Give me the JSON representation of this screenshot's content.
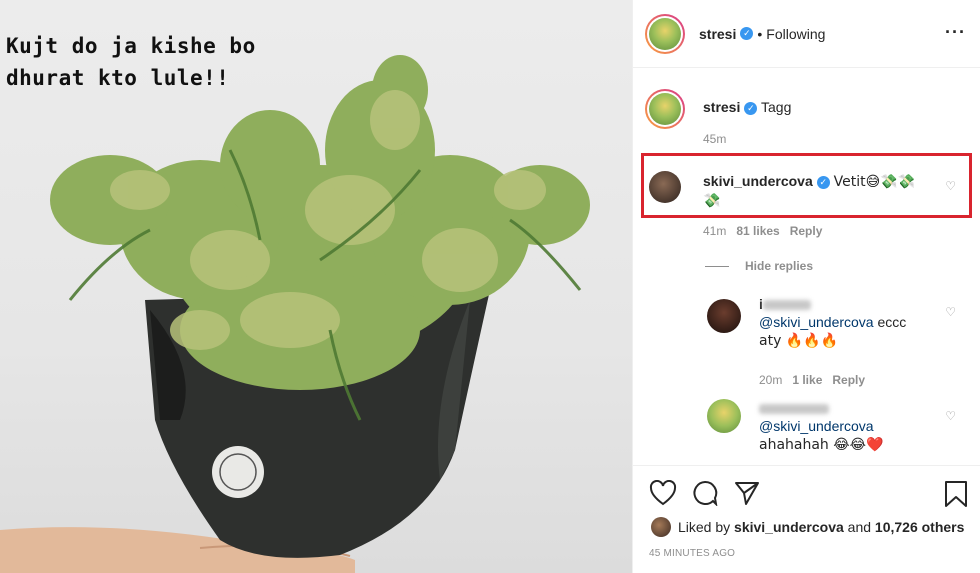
{
  "image": {
    "caption_text": "Kujt do ja kishe bo\ndhurat kto lule!!"
  },
  "header": {
    "username": "stresi",
    "separator": "•",
    "follow_label": "Following",
    "more_icon": "more-horizontal-icon"
  },
  "caption_comment": {
    "username": "stresi",
    "text": "Tagg",
    "time": "45m"
  },
  "comments": [
    {
      "username": "skivi_undercova",
      "verified": true,
      "text": "Vetit😅💸💸",
      "text2": "💸",
      "time": "41m",
      "likes": "81 likes",
      "reply_label": "Reply",
      "highlighted": true
    }
  ],
  "hide_replies_label": "Hide replies",
  "replies": [
    {
      "username_blurred": "i",
      "text_mention": "@skivi_undercova",
      "text_rest": " eccc",
      "text_line2": "aty 🔥🔥🔥",
      "time": "20m",
      "likes": "1 like",
      "reply_label": "Reply"
    },
    {
      "username_blurred": "",
      "text_mention": "@skivi_undercova",
      "text_line2": "ahahahah 😂😂❤️"
    }
  ],
  "actions": {
    "icons": [
      "heart-icon",
      "comment-icon",
      "share-icon",
      "bookmark-icon"
    ],
    "liked_by_prefix": "Liked by ",
    "liked_by_user": "skivi_undercova",
    "liked_by_and": " and ",
    "liked_by_count": "10,726 others",
    "timestamp": "45 MINUTES AGO"
  },
  "colors": {
    "highlight_border": "#d9242e",
    "verified": "#3897f0",
    "mention": "#00376b",
    "meta_gray": "#8e8e8e"
  }
}
